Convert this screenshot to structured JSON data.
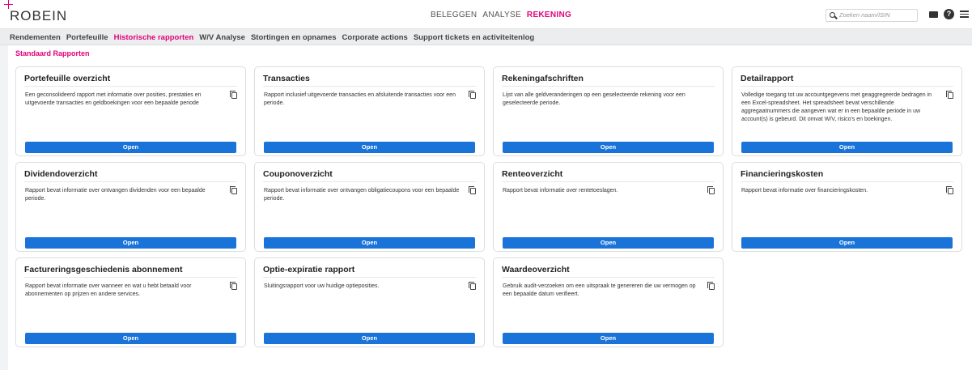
{
  "header": {
    "logo": "ROBEIN",
    "nav": [
      "BELEGGEN",
      "ANALYSE",
      "REKENING"
    ],
    "active_nav": "REKENING",
    "search_placeholder": "Zoeken naam/ISIN",
    "icons": [
      "search-icon",
      "mail-icon",
      "help-icon",
      "menu-icon"
    ],
    "help_glyph": "?"
  },
  "subnav": {
    "items": [
      "Rendementen",
      "Portefeuille",
      "Historische rapporten",
      "W/V Analyse",
      "Stortingen en opnames",
      "Corporate actions",
      "Support tickets en activiteitenlog"
    ],
    "active": "Historische rapporten"
  },
  "main": {
    "section_title": "Standaard Rapporten",
    "cards": [
      {
        "title": "Portefeuille overzicht",
        "description": "Een geconsolideerd rapport met informatie over posities, prestaties en uitgevoerde transacties en geldboekingen voor een bepaalde periode",
        "button": "Open"
      },
      {
        "title": "Transacties",
        "description": "Rapport inclusief uitgevoerde transacties en afsluitende transacties voor een periode.",
        "button": "Open"
      },
      {
        "title": "Rekeningafschriften",
        "description": "Lijst van alle geldveranderingen op een geselecteerde rekening voor een geselecteerde periode.",
        "button": "Open"
      },
      {
        "title": "Detailrapport",
        "description": "Volledige toegang tot uw accountgegevens met geaggregeerde bedragen in een Excel-spreadsheet. Het spreadsheet bevat verschillende aggregaatnummers die aangeven wat er in een bepaalde periode in uw account(s) is gebeurd. Dit omvat W/V, risico's en boekingen.",
        "button": "Open"
      },
      {
        "title": "Dividendoverzicht",
        "description": "Rapport bevat informatie over ontvangen dividenden voor een bepaalde periode.",
        "button": "Open"
      },
      {
        "title": "Couponoverzicht",
        "description": "Rapport bevat informatie over ontvangen obligatiecoupons voor een bepaalde periode.",
        "button": "Open"
      },
      {
        "title": "Renteoverzicht",
        "description": "Rapport bevat informatie over rentetoeslagen.",
        "button": "Open"
      },
      {
        "title": "Financieringskosten",
        "description": "Rapport bevat informatie over financieringskosten.",
        "button": "Open"
      },
      {
        "title": "Factureringsgeschiedenis abonnement",
        "description": "Rapport bevat informatie over wanneer en wat u hebt betaald voor abonnementen op prijzen en andere services.",
        "button": "Open"
      },
      {
        "title": "Optie-expiratie rapport",
        "description": "Sluitingsrapport voor uw huidige optieposities.",
        "button": "Open"
      },
      {
        "title": "Waardeoverzicht",
        "description": "Gebruik audit-verzoeken om een uitspraak te genereren die uw vermogen op een bepaalde datum verifieert.",
        "button": "Open"
      }
    ]
  },
  "colors": {
    "accent": "#e2007a",
    "button": "#1a73d9"
  }
}
